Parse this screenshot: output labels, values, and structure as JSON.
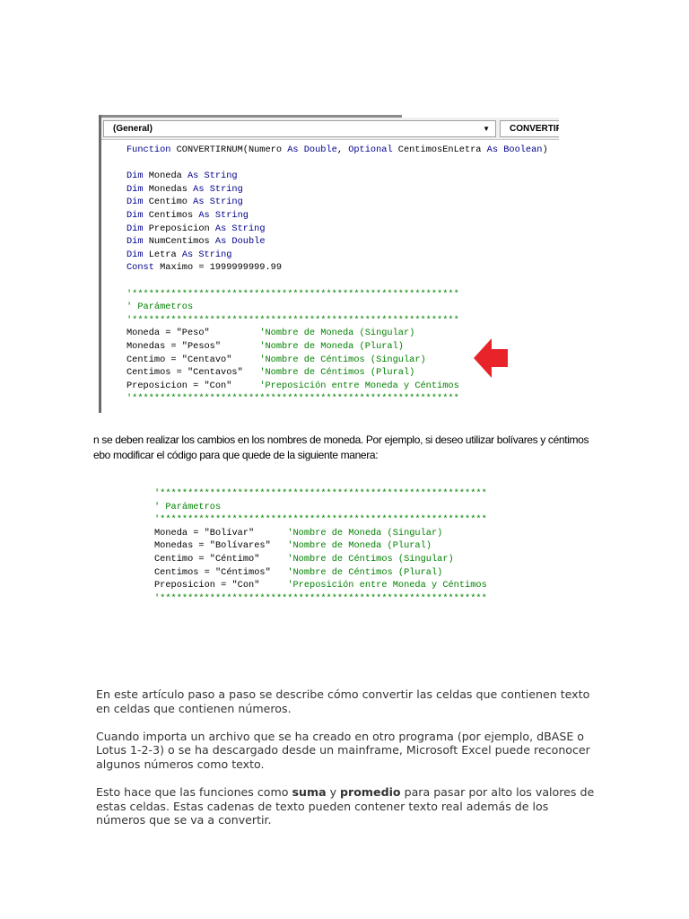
{
  "editor": {
    "object_combo": "(General)",
    "procedure_combo": "CONVERTIRNUM",
    "code_lines": [
      [
        {
          "t": "Function",
          "c": "k"
        },
        {
          "t": " CONVERTIRNUM(Numero "
        },
        {
          "t": "As Double",
          "c": "k"
        },
        {
          "t": ", "
        },
        {
          "t": "Optional",
          "c": "k"
        },
        {
          "t": " CentimosEnLetra "
        },
        {
          "t": "As Boolean",
          "c": "k"
        },
        {
          "t": ")"
        }
      ],
      [],
      [
        {
          "t": "Dim",
          "c": "k"
        },
        {
          "t": " Moneda "
        },
        {
          "t": "As String",
          "c": "k"
        }
      ],
      [
        {
          "t": "Dim",
          "c": "k"
        },
        {
          "t": " Monedas "
        },
        {
          "t": "As String",
          "c": "k"
        }
      ],
      [
        {
          "t": "Dim",
          "c": "k"
        },
        {
          "t": " Centimo "
        },
        {
          "t": "As String",
          "c": "k"
        }
      ],
      [
        {
          "t": "Dim",
          "c": "k"
        },
        {
          "t": " Centimos "
        },
        {
          "t": "As String",
          "c": "k"
        }
      ],
      [
        {
          "t": "Dim",
          "c": "k"
        },
        {
          "t": " Preposicion "
        },
        {
          "t": "As String",
          "c": "k"
        }
      ],
      [
        {
          "t": "Dim",
          "c": "k"
        },
        {
          "t": " NumCentimos "
        },
        {
          "t": "As Double",
          "c": "k"
        }
      ],
      [
        {
          "t": "Dim",
          "c": "k"
        },
        {
          "t": " Letra "
        },
        {
          "t": "As String",
          "c": "k"
        }
      ],
      [
        {
          "t": "Const",
          "c": "k"
        },
        {
          "t": " Maximo = 1999999999.99"
        }
      ],
      [],
      [
        {
          "t": "'***********************************************************",
          "c": "c"
        }
      ],
      [
        {
          "t": "' Parámetros",
          "c": "c"
        }
      ],
      [
        {
          "t": "'***********************************************************",
          "c": "c"
        }
      ],
      [
        {
          "t": "Moneda = \"Peso\"         "
        },
        {
          "t": "'Nombre de Moneda (Singular)",
          "c": "c"
        }
      ],
      [
        {
          "t": "Monedas = \"Pesos\"       "
        },
        {
          "t": "'Nombre de Moneda (Plural)",
          "c": "c"
        }
      ],
      [
        {
          "t": "Centimo = \"Centavo\"     "
        },
        {
          "t": "'Nombre de Céntimos (Singular)",
          "c": "c"
        }
      ],
      [
        {
          "t": "Centimos = \"Centavos\"   "
        },
        {
          "t": "'Nombre de Céntimos (Plural)",
          "c": "c"
        }
      ],
      [
        {
          "t": "Preposicion = \"Con\"     "
        },
        {
          "t": "'Preposición entre Moneda y Céntimos",
          "c": "c"
        }
      ],
      [
        {
          "t": "'***********************************************************",
          "c": "c"
        }
      ]
    ]
  },
  "instructions": {
    "line1": "n se deben realizar los cambios en los nombres de moneda. Por ejemplo, si deseo utilizar bolívares y céntimos",
    "line2": "ebo modificar el código para que quede de la siguiente manera:"
  },
  "code_example": {
    "code_lines": [
      [
        {
          "t": "'***********************************************************",
          "c": "c"
        }
      ],
      [
        {
          "t": "' Parámetros",
          "c": "c"
        }
      ],
      [
        {
          "t": "'***********************************************************",
          "c": "c"
        }
      ],
      [
        {
          "t": "Moneda = \"Bolívar\"      "
        },
        {
          "t": "'Nombre de Moneda (Singular)",
          "c": "c"
        }
      ],
      [
        {
          "t": "Monedas = \"Bolívares\"   "
        },
        {
          "t": "'Nombre de Moneda (Plural)",
          "c": "c"
        }
      ],
      [
        {
          "t": "Centimo = \"Céntimo\"     "
        },
        {
          "t": "'Nombre de Céntimos (Singular)",
          "c": "c"
        }
      ],
      [
        {
          "t": "Centimos = \"Céntimos\"   "
        },
        {
          "t": "'Nombre de Céntimos (Plural)",
          "c": "c"
        }
      ],
      [
        {
          "t": "Preposicion = \"Con\"     "
        },
        {
          "t": "'Preposición entre Moneda y Céntimos",
          "c": "c"
        }
      ],
      [
        {
          "t": "'***********************************************************",
          "c": "c"
        }
      ]
    ]
  },
  "article": {
    "p1": "En este artículo paso a paso se describe cómo convertir las celdas que contienen texto en celdas que contienen números.",
    "p2": "Cuando importa un archivo que se ha creado en otro programa (por ejemplo, dBASE o Lotus 1-2-3) o se ha descargado desde un mainframe, Microsoft Excel puede reconocer algunos números como texto.",
    "p3_before": "Esto hace que las funciones como ",
    "p3_bold1": "suma",
    "p3_mid": " y ",
    "p3_bold2": "promedio",
    "p3_after": " para pasar por alto los valores de estas celdas. Estas cadenas de texto pueden contener texto real además de los números que se va a convertir."
  },
  "colors": {
    "keyword": "#00008b",
    "comment": "#008000",
    "arrow": "#e8242a"
  }
}
